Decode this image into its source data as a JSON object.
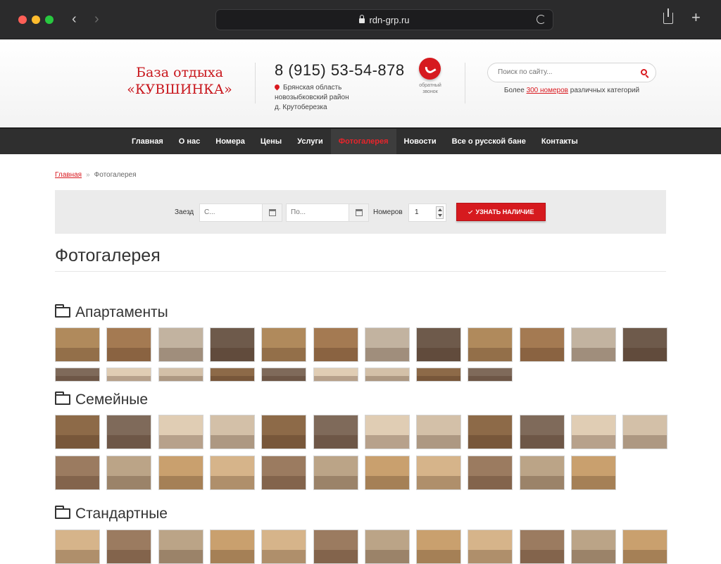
{
  "browser": {
    "url": "rdn-grp.ru"
  },
  "header": {
    "logo_line1": "База отдыха",
    "logo_line2": "«КУВШИНКА»",
    "phone": "8 (915) 53-54-878",
    "address_line1": "Брянская область",
    "address_line2": "новозыбковский район",
    "address_line3": "д. Крутоберезка",
    "call_label_line1": "обратный",
    "call_label_line2": "звонок",
    "search_placeholder": "Поиск по сайту...",
    "hint_before": "Более ",
    "hint_link": "300 номеров",
    "hint_after": " различных категорий"
  },
  "nav": {
    "items": [
      {
        "label": "Главная",
        "active": false
      },
      {
        "label": "О нас",
        "active": false
      },
      {
        "label": "Номера",
        "active": false
      },
      {
        "label": "Цены",
        "active": false
      },
      {
        "label": "Услуги",
        "active": false
      },
      {
        "label": "Фотогалерея",
        "active": true
      },
      {
        "label": "Новости",
        "active": false
      },
      {
        "label": "Все о русской бане",
        "active": false
      },
      {
        "label": "Контакты",
        "active": false
      }
    ]
  },
  "breadcrumb": {
    "home": "Главная",
    "separator": "»",
    "current": "Фотогалерея"
  },
  "booking": {
    "checkin_label": "Заезд",
    "from_placeholder": "С...",
    "to_placeholder": "По...",
    "rooms_label": "Номеров",
    "rooms_value": "1",
    "button_label": "УЗНАТЬ НАЛИЧИЕ"
  },
  "page": {
    "title": "Фотогалерея"
  },
  "albums": [
    {
      "title": "Апартаменты",
      "row1": 12,
      "row2": 9
    },
    {
      "title": "Семейные",
      "row1": 12,
      "row2": 11
    },
    {
      "title": "Стандартные",
      "row1": 12
    }
  ],
  "colors": {
    "accent": "#d61a1f",
    "nav_bg": "#2f2f2f"
  }
}
